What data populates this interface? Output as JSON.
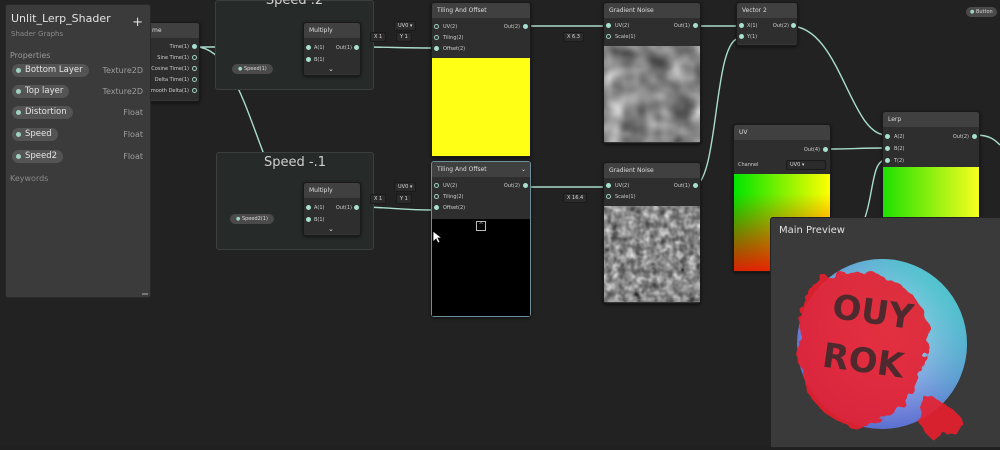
{
  "blackboard": {
    "title": "Unlit_Lerp_Shader",
    "subtitle": "Shader Graphs",
    "add_label": "+",
    "section_properties": "Properties",
    "properties": [
      {
        "name": "Bottom Layer",
        "type": "Texture2D"
      },
      {
        "name": "Top layer",
        "type": "Texture2D"
      },
      {
        "name": "Distortion",
        "type": "Float"
      },
      {
        "name": "Speed",
        "type": "Float"
      },
      {
        "name": "Speed2",
        "type": "Float"
      }
    ],
    "section_keywords": "Keywords"
  },
  "groups": {
    "speed_top": "Speed .2",
    "speed_bottom": "Speed -.1"
  },
  "time_node": {
    "title": "me",
    "outputs": [
      "Time(1)",
      "Sine Time(1)",
      "Cosine Time(1)",
      "Delta Time(1)",
      "mooth Delta(1)"
    ]
  },
  "multiply_top": {
    "title": "Multiply",
    "in_a": "A(1)",
    "in_b": "B(1)",
    "out": "Out(1)",
    "prop": "Speed(1)"
  },
  "multiply_bottom": {
    "title": "Multiply",
    "in_a": "A(1)",
    "in_b": "B(1)",
    "out": "Out(1)",
    "prop": "Speed2(1)"
  },
  "tiling_top": {
    "title": "Tiling And Offset",
    "uv_select": "UV0",
    "tiling_x_label": "X",
    "tiling_x": "1",
    "tiling_y_label": "Y",
    "tiling_y": "1",
    "in_uv": "UV(2)",
    "in_tiling": "Tiling(2)",
    "in_offset": "Offset(2)",
    "out": "Out(2)",
    "preview_color": "#ffff16"
  },
  "tiling_bottom": {
    "title": "Tiling And Offset",
    "uv_select": "UV0",
    "tiling_x_label": "X",
    "tiling_x": "1",
    "tiling_y_label": "Y",
    "tiling_y": "1",
    "in_uv": "UV(2)",
    "in_tiling": "Tiling(2)",
    "in_offset": "Offset(2)",
    "out": "Out(2)",
    "preview_color": "#000000"
  },
  "noise_top": {
    "title": "Gradient Noise",
    "in_uv": "UV(2)",
    "in_scale": "Scale(1)",
    "out": "Out(1)",
    "scale_label": "X",
    "scale": "6.3"
  },
  "noise_bottom": {
    "title": "Gradient Noise",
    "in_uv": "UV(2)",
    "in_scale": "Scale(1)",
    "out": "Out(1)",
    "scale_label": "X",
    "scale": "16.4"
  },
  "vector2": {
    "title": "Vector 2",
    "in_x": "X(1)",
    "in_y": "Y(1)",
    "out": "Out(2)"
  },
  "uv_node": {
    "title": "UV",
    "out": "Out(4)",
    "channel_label": "Channel",
    "channel": "UV0"
  },
  "lerp_node": {
    "title": "Lerp",
    "in_a": "A(2)",
    "in_b": "B(2)",
    "in_t": "T(2)",
    "out": "Out(2)"
  },
  "main_preview": {
    "title": "Main Preview",
    "logo_line1": "OUY",
    "logo_line2": "ROK"
  },
  "top_right_pill": "Button"
}
